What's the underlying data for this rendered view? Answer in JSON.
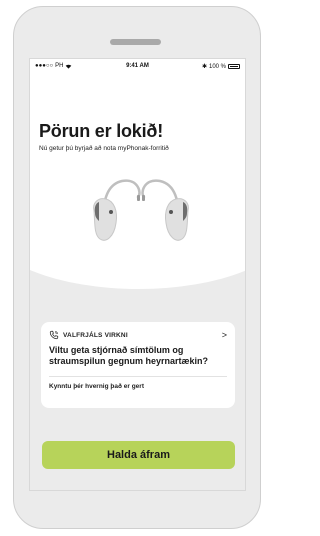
{
  "status_bar": {
    "carrier": "PH",
    "time": "9:41 AM",
    "battery": "100 %"
  },
  "main": {
    "title": "Pörun er lokið!",
    "subtitle": "Nú getur þú byrjað að nota myPhonak-forritið"
  },
  "feature_card": {
    "label": "VALFRJÁLS VIRKNI",
    "chevron": ">",
    "text": "Viltu geta stjórnað símtölum og straumspilun gegnum heyrnartækin?",
    "link": "Kynntu þér hvernig það er gert"
  },
  "actions": {
    "continue_label": "Halda áfram"
  },
  "colors": {
    "accent": "#b7d35a",
    "background_grey": "#ebebeb"
  },
  "icons": {
    "card_icon": "phone-icon",
    "hero": "hearing-aids-illustration"
  }
}
